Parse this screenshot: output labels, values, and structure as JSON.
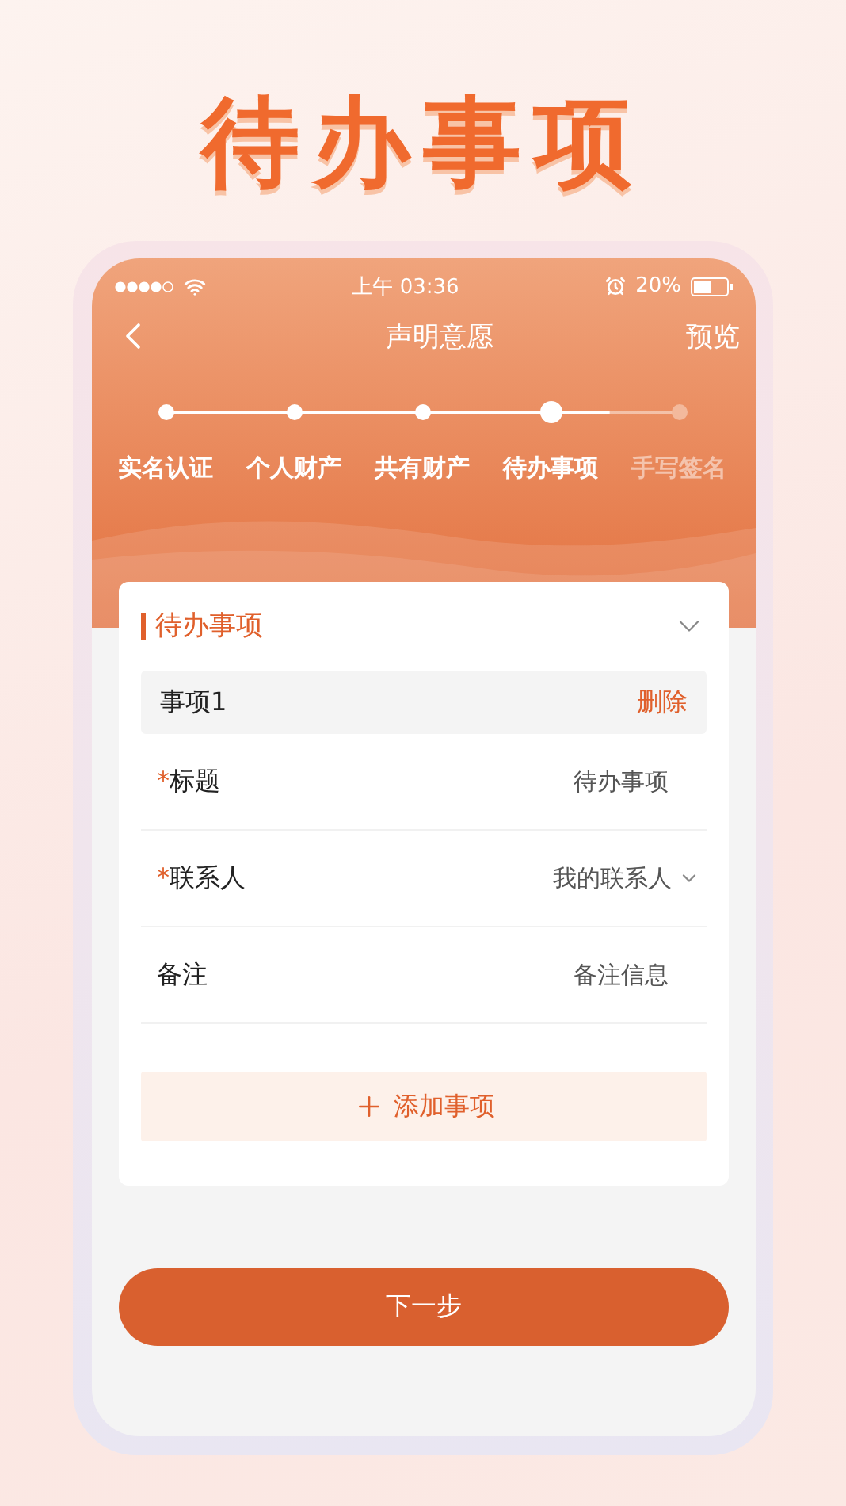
{
  "headline": "待办事项",
  "status_bar": {
    "time": "上午 03:36",
    "battery": "20%"
  },
  "nav": {
    "title": "声明意愿",
    "action": "预览"
  },
  "steps": [
    {
      "label": "实名认证",
      "done": true,
      "current": false
    },
    {
      "label": "个人财产",
      "done": true,
      "current": false
    },
    {
      "label": "共有财产",
      "done": true,
      "current": false
    },
    {
      "label": "待办事项",
      "done": false,
      "current": true
    },
    {
      "label": "手写签名",
      "done": false,
      "current": false
    }
  ],
  "section": {
    "title": "待办事项",
    "expanded": true
  },
  "items": [
    {
      "title": "事项1",
      "delete": "删除",
      "fields": [
        {
          "label": "标题",
          "marker": "*",
          "value": "待办事项",
          "dropdown": false
        },
        {
          "label": "联系人",
          "marker": "*",
          "value": "我的联系人",
          "dropdown": true
        },
        {
          "label": "备注",
          "value": "备注信息",
          "dropdown": false
        }
      ]
    }
  ],
  "add_button": "添加事项",
  "next_button": "下一步"
}
